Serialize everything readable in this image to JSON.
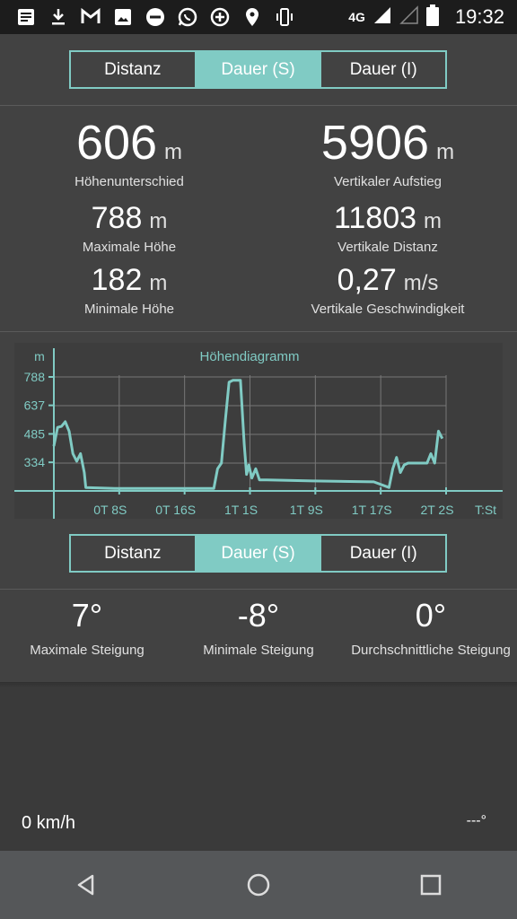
{
  "status_bar": {
    "time": "19:32",
    "network": "4G",
    "icons": [
      "news-icon",
      "download-icon",
      "gmail-icon",
      "image-icon",
      "dnd-icon",
      "whatsapp-icon",
      "data-saver-icon",
      "location-icon",
      "vibrate-icon",
      "signal-icon",
      "signal-icon-2",
      "battery-icon"
    ]
  },
  "tabs_top": {
    "items": [
      "Distanz",
      "Dauer (S)",
      "Dauer (I)"
    ],
    "active_index": 1
  },
  "stats": {
    "height_difference": {
      "value": "606",
      "unit": "m",
      "label": "Höhenunterschied"
    },
    "vertical_ascent": {
      "value": "5906",
      "unit": "m",
      "label": "Vertikaler Aufstieg"
    },
    "max_height": {
      "value": "788",
      "unit": "m",
      "label": "Maximale Höhe"
    },
    "vertical_distance": {
      "value": "11803",
      "unit": "m",
      "label": "Vertikale Distanz"
    },
    "min_height": {
      "value": "182",
      "unit": "m",
      "label": "Minimale Höhe"
    },
    "vertical_speed": {
      "value": "0,27",
      "unit": "m/s",
      "label": "Vertikale Geschwindigkeit"
    }
  },
  "chart_data": {
    "type": "line",
    "title": "Höhendiagramm",
    "ylabel": "m",
    "xlabel": "T:St",
    "x_ticks": [
      "0T 8S",
      "0T 16S",
      "1T 1S",
      "1T 9S",
      "1T 17S",
      "2T 2S"
    ],
    "y_ticks": [
      788,
      637,
      485,
      334
    ],
    "color": "#80cbc4",
    "series": [
      {
        "values": [
          [
            0,
            420
          ],
          [
            0.5,
            520
          ],
          [
            1,
            525
          ],
          [
            1.5,
            550
          ],
          [
            2,
            500
          ],
          [
            2.5,
            380
          ],
          [
            3,
            340
          ],
          [
            3.5,
            380
          ],
          [
            4,
            280
          ],
          [
            4.2,
            200
          ],
          [
            8,
            195
          ],
          [
            16,
            195
          ],
          [
            21,
            195
          ],
          [
            21.5,
            300
          ],
          [
            22,
            330
          ],
          [
            22.5,
            550
          ],
          [
            23,
            760
          ],
          [
            23.5,
            770
          ],
          [
            24.5,
            770
          ],
          [
            25,
            430
          ],
          [
            25.3,
            270
          ],
          [
            25.6,
            320
          ],
          [
            26,
            250
          ],
          [
            26.5,
            300
          ],
          [
            27,
            240
          ],
          [
            28,
            240
          ],
          [
            34,
            235
          ],
          [
            42,
            230
          ],
          [
            44,
            200
          ],
          [
            44.5,
            300
          ],
          [
            45,
            360
          ],
          [
            45.5,
            280
          ],
          [
            46,
            320
          ],
          [
            46.5,
            330
          ],
          [
            49,
            330
          ],
          [
            49.5,
            380
          ],
          [
            50,
            330
          ],
          [
            50.5,
            500
          ],
          [
            51,
            460
          ]
        ]
      }
    ]
  },
  "tabs_bottom": {
    "items": [
      "Distanz",
      "Dauer (S)",
      "Dauer (I)"
    ],
    "active_index": 1
  },
  "slopes": {
    "max": {
      "value": "7°",
      "label": "Maximale Steigung"
    },
    "min": {
      "value": "-8°",
      "label": "Minimale Steigung"
    },
    "avg": {
      "value": "0°",
      "label": "Durchschnittliche Steigung"
    }
  },
  "footer": {
    "speed": "0 km/h",
    "heading": "---°"
  },
  "navbar": [
    "back-icon",
    "home-icon",
    "recents-icon"
  ]
}
